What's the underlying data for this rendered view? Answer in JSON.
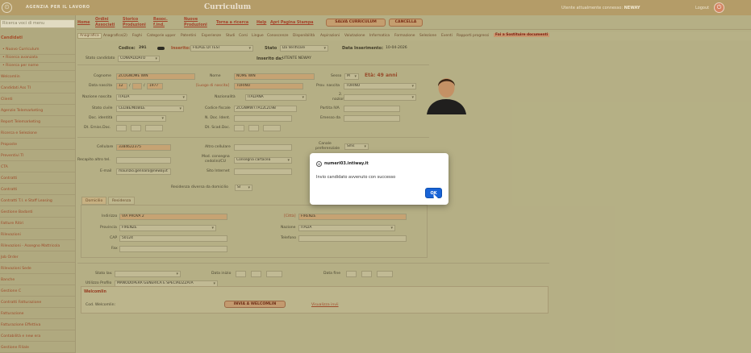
{
  "header": {
    "agency": "AGENZIA PER IL LAVORO",
    "title": "Curriculum",
    "user_label": "Utente attualmente connesso:",
    "user_name": "NEWAY",
    "logout": "Logout"
  },
  "sidebar": {
    "search_placeholder": "Ricerca voci di menu",
    "section": "Candidati",
    "items": [
      "• Nuovo Curriculum",
      "• Ricerca avanzata",
      "• Ricerca per nome",
      "Welcomlin",
      "Candidati Ass TI",
      "Clienti",
      "Agenzie Telemarketing",
      "Report Telemarketing",
      "Ricerca e Selezione",
      "Proposte",
      "Preventivi TI",
      "CTA",
      "Contratti",
      "Contratti",
      "Contratti T.I. e Staff Leasing",
      "Gestione Badanti",
      "Fatture Ritiri",
      "Rilevazioni",
      "Rilevazioni - Assegno Mattricola",
      "Job Order",
      "Rilevazioni Sede",
      "Banche",
      "Gestione C",
      "Contratti Fatturazione",
      "Fatturazione",
      "Fatturazione Effettiva",
      "Contabilità e new era",
      "Gestione Filiale"
    ]
  },
  "menu": {
    "home": "Home",
    "ordini_1": "Ordini",
    "ordini_2": "Associati",
    "storico_1": "Storico",
    "storico_2": "Produzioni",
    "resoc_1": "Resoc.",
    "resoc_2": "f.ind.",
    "nuove_1": "Nuove",
    "nuove_2": "Produzioni",
    "torna": "Torna a ricerca",
    "help": "Help",
    "apri": "Apri Pagina Stampa",
    "salva": "SALVA CURRICULUM",
    "cancella": "CANCELLA"
  },
  "tabs": [
    "Anagrafica",
    "Anagrafica(2)",
    "Foghi",
    "Categorie upper",
    "Patentini",
    "Esperienze",
    "Studi",
    "Corsi",
    "Lingue",
    "Conoscenze",
    "Disponibilità",
    "Aspirazioni",
    "Valutazione",
    "Informatica",
    "Formazione",
    "Selezione",
    "Eventi",
    "Rapporti progressi",
    "Fai a Sostituire documenti"
  ],
  "record": {
    "codice_label": "Codice:",
    "codice": "291",
    "inserito_label": "Inserito:",
    "inserito": "FILIALE DI TEST",
    "stato_label": "Stato",
    "stato": "Da Verificare",
    "data_ins_label": "Data Inserimento:",
    "data_ins": "10-04-2026",
    "stato_cand_label": "Stato candidato",
    "stato_cand": "CONVALIDATO",
    "inserito_da_label": "Inserito da:",
    "inserito_da": "UTENTE NEWAY"
  },
  "anagrafica": {
    "cognome_label": "Cognome",
    "cognome": "ZCOGNOME WIN",
    "nome_label": "Nome",
    "nome": "NOME WIN",
    "sesso_label": "Sesso",
    "sesso": "M",
    "eta": "Età: 49 anni",
    "data_nascita_label": "Data nascita",
    "dn_g": "12",
    "dn_m": "",
    "dn_a": "1977",
    "luogo_label": "[Luogo di nascita]",
    "luogo": "TORINO",
    "prov_nascita_label": "Prov. nascita",
    "prov_nascita": "TORINO",
    "nazione_nascita_label": "Nazione nascita",
    "nazione_nascita": "ITALIA",
    "nazionalita_label": "Nazionalità",
    "nazionalita": "ITALIANA",
    "naz2_label_1": "2.",
    "naz2_label_2": "nazionalità",
    "stato_civile_label": "Stato civile",
    "stato_civile": "CELIBE/NUBILE",
    "cf_label": "Codice fiscale",
    "cf": "ZCGNMW77A12L219B",
    "piva_label": "Partita IVA",
    "doc_label": "Doc. identità",
    "ndoc_label": "N. Doc. Ident.",
    "emesso_label": "Emesso da",
    "dt_emiss_label": "Dt. Emiss.Doc.",
    "dt_scad_label": "Dt. Scad.Doc."
  },
  "contatti": {
    "cellulare_label": "Cellulare",
    "cellulare": "3384622375",
    "altro_label": "Altro cellulare",
    "canale_label_1": "Canale",
    "canale_label_2": "preferenziale",
    "canale": "Sms",
    "recapito_label": "Recapito altro tel.",
    "mod_label_1": "Mod. consegna",
    "mod_label_2": "cedolini/CU",
    "mod": "Consegna cartacea",
    "email_label": "E-mail",
    "email": "maurizio.gennaro@neway.it",
    "sito_label": "Sito Internet",
    "residenza_label": "Residenza diversa da domicilio",
    "residenza": "SI"
  },
  "domicilio": {
    "tab_domicilio": "Domicilio",
    "tab_residenza": "Residenza",
    "indirizzo_label": "Indirizzo",
    "indirizzo": "VIA PROVA 2",
    "citta_label": "[Città]",
    "citta": "FIRENZE",
    "provincia_label": "Provincia",
    "provincia": "FIRENZE",
    "nazione_label": "Nazione",
    "nazione": "ITALIA",
    "cap_label": "CAP",
    "cap": "50124",
    "telefono_label": "Telefono",
    "fax_label": "Fax"
  },
  "lavoro": {
    "stato_lav_label": "Stato lav.",
    "data_inizio_label": "Data inizio",
    "data_fine_label": "Data fine",
    "utilizzo_label": "Utilizzo Profilo",
    "utilizzo": "MANODOPERA GENERICA E SPECIALIZZATA"
  },
  "welcomlin": {
    "title": "Welcomlin",
    "cod_label": "Cod. Welcomlin:",
    "button": "INVIA A WELCOMLIN",
    "link": "Visualizza invii"
  },
  "dialog": {
    "site": "numeri03.intiway.it",
    "message": "Invio candidato avvenuto con successo",
    "ok": "OK"
  }
}
